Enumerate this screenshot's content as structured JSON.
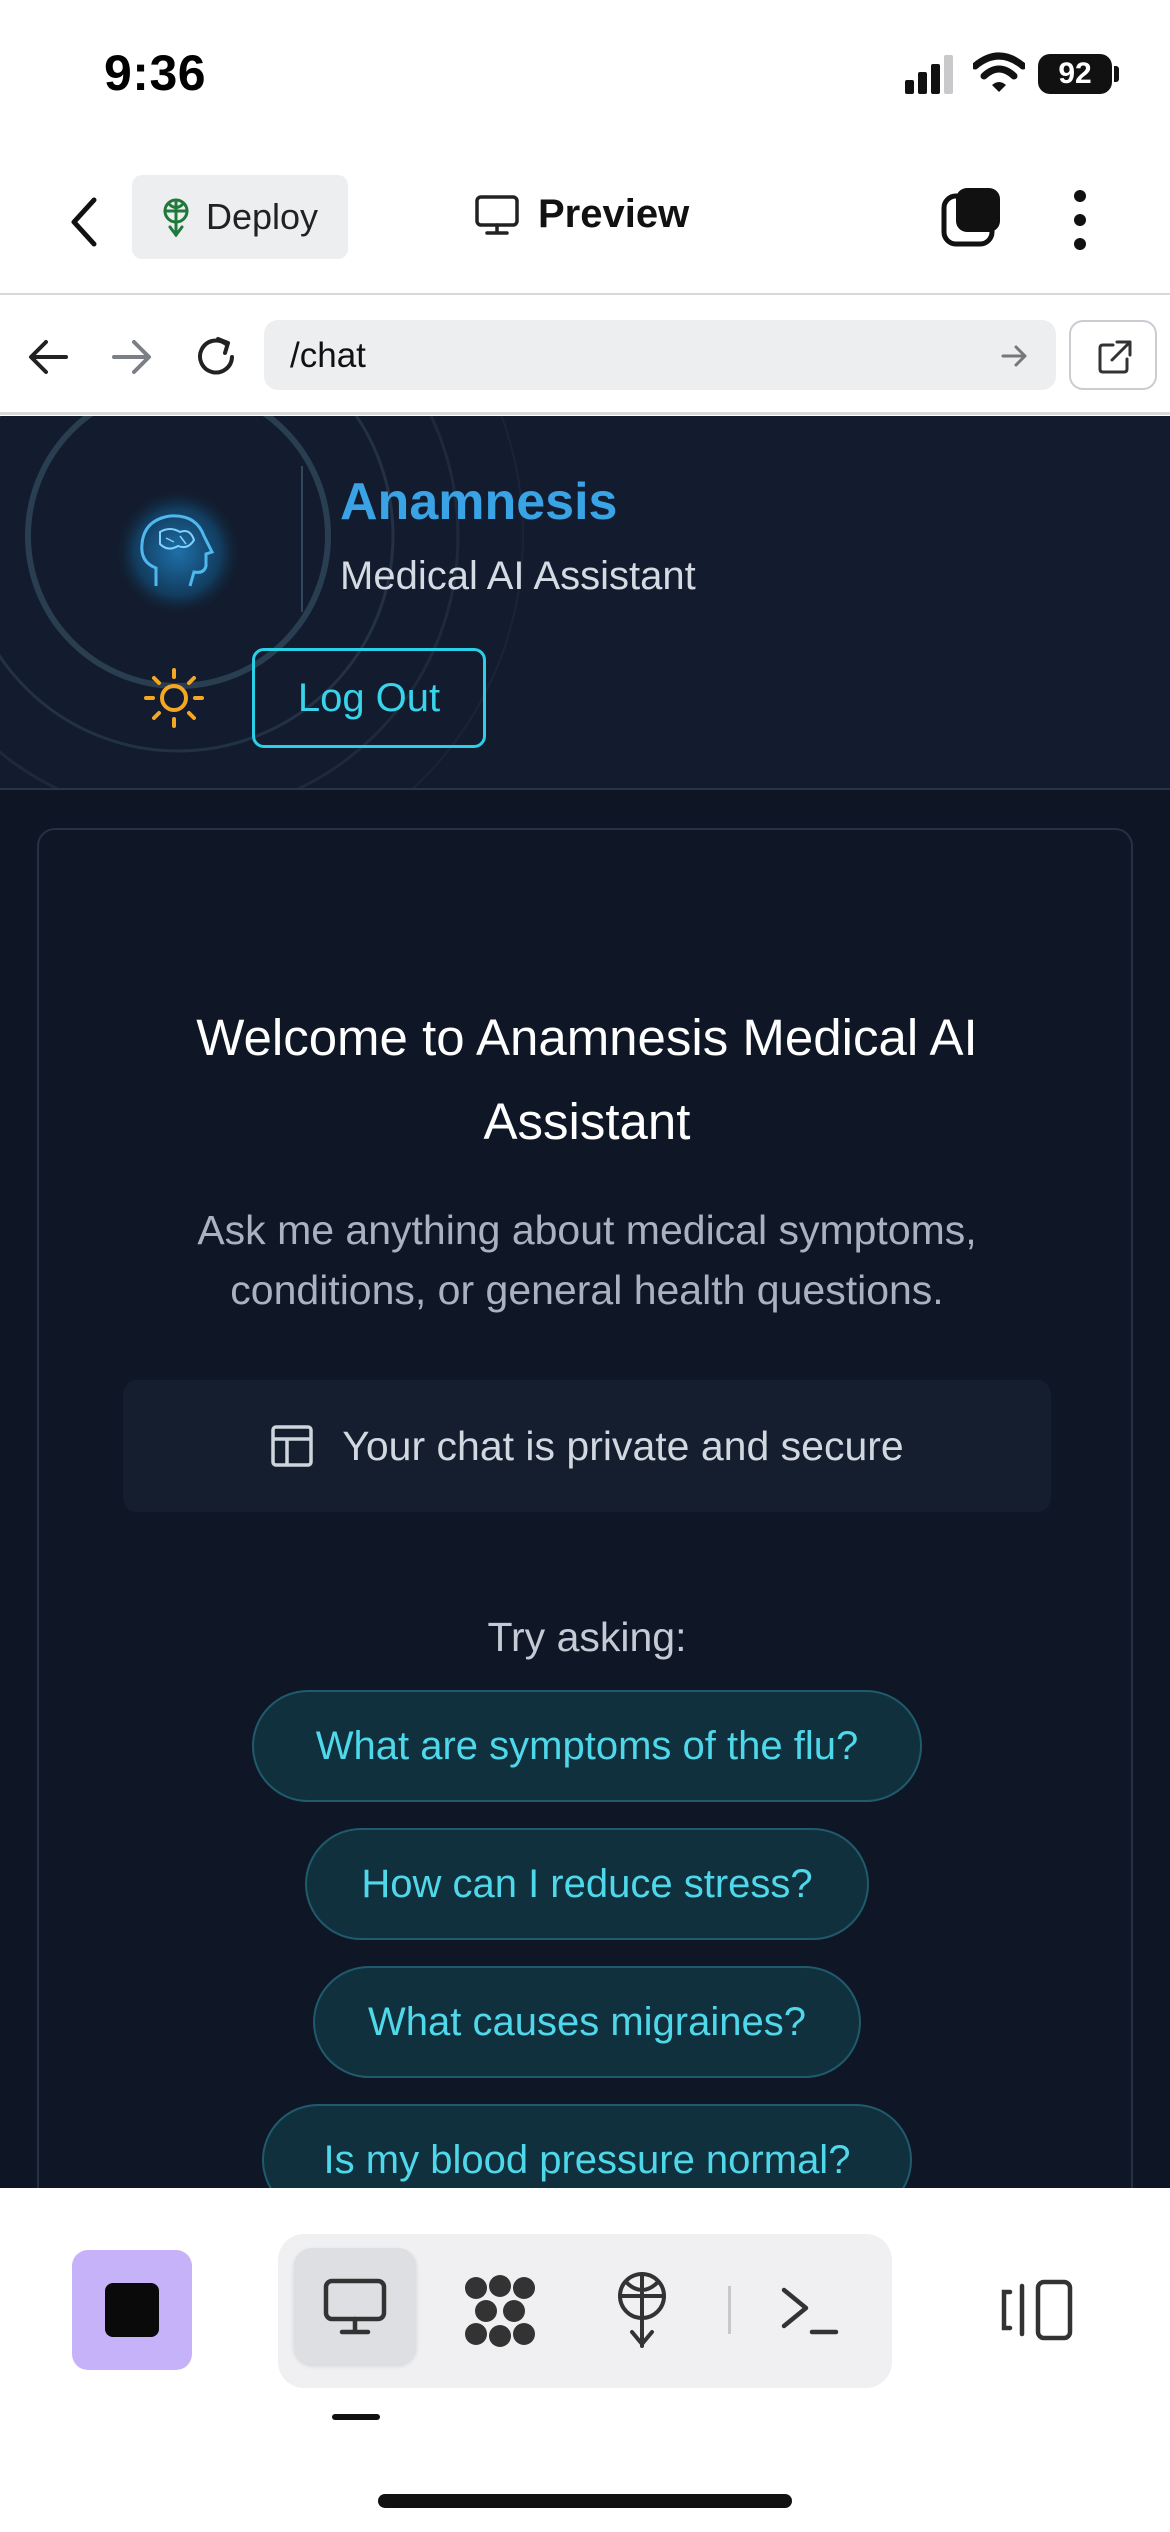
{
  "status_bar": {
    "time": "9:36",
    "battery": "92"
  },
  "toolbar": {
    "deploy_label": "Deploy",
    "preview_label": "Preview"
  },
  "browser": {
    "url": "/chat"
  },
  "app": {
    "brand_title": "Anamnesis",
    "brand_subtitle": "Medical AI Assistant",
    "logout_label": "Log Out"
  },
  "chat": {
    "welcome_title": "Welcome to Anamnesis Medical AI Assistant",
    "welcome_subtitle": "Ask me anything about medical symptoms, conditions, or general health questions.",
    "privacy_text": "Your chat is private and secure",
    "try_label": "Try asking:",
    "suggestions": [
      "What are symptoms of the flu?",
      "How can I reduce stress?",
      "What causes migraines?",
      "Is my blood pressure normal?"
    ]
  },
  "colors": {
    "page_bg": "#0e1525",
    "accent_cyan": "#39d3ea",
    "brand_blue": "#3aa3e6",
    "stop_button_bg": "#c6b2f8",
    "sun_icon": "#f5a623"
  },
  "icons": [
    "back-icon",
    "deploy-icon",
    "monitor-icon",
    "tabs-icon",
    "more-icon",
    "arrow-left-icon",
    "arrow-right-icon",
    "reload-icon",
    "go-icon",
    "external-link-icon",
    "brain-logo-icon",
    "sun-icon",
    "layout-icon",
    "stop-icon",
    "workspace-icon",
    "deploy-tab-icon",
    "terminal-icon",
    "device-switch-icon"
  ]
}
